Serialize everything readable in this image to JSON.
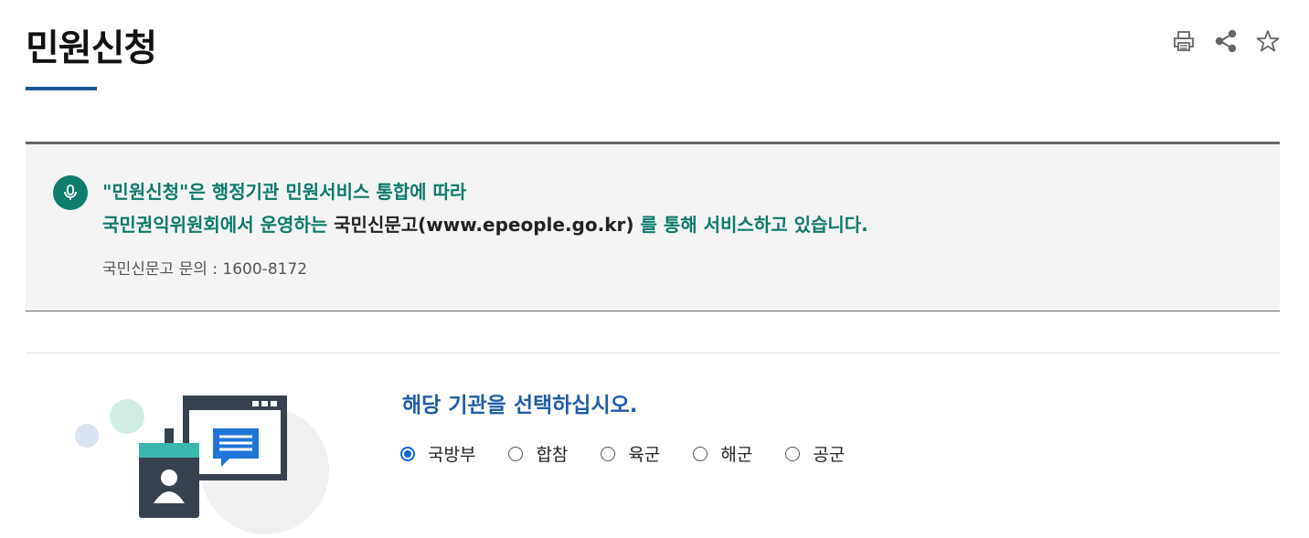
{
  "page": {
    "title": "민원신청"
  },
  "toolbar": {
    "icons": [
      "print-icon",
      "share-icon",
      "star-icon"
    ]
  },
  "notice": {
    "line1": "\"민원신청\"은 행정기관 민원서비스 통합에 따라",
    "line2_prefix": "국민권익위원회에서 운영하는 ",
    "line2_site": "국민신문고(www.epeople.go.kr)",
    "line2_suffix": " 를 통해 서비스하고 있습니다.",
    "contact": "국민신문고 문의 : 1600-8172"
  },
  "selection": {
    "prompt": "해당 기관을 선택하십시오.",
    "options": [
      {
        "label": "국방부",
        "checked": true
      },
      {
        "label": "합참",
        "checked": false
      },
      {
        "label": "육군",
        "checked": false
      },
      {
        "label": "해군",
        "checked": false
      },
      {
        "label": "공군",
        "checked": false
      }
    ]
  },
  "colors": {
    "accent_blue": "#1a5a96",
    "notice_green": "#0b7a6a",
    "prompt_blue": "#1f5da8",
    "radio_blue": "#0a66d8"
  }
}
